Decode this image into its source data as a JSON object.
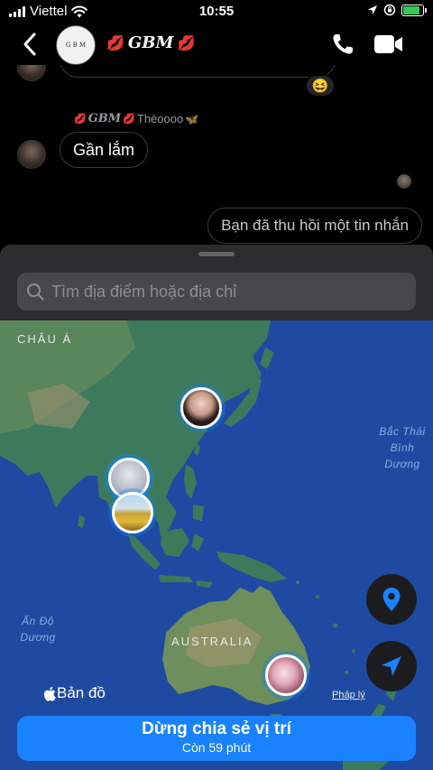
{
  "status_bar": {
    "carrier": "Viettel",
    "time": "10:55",
    "battery_level": 0.9,
    "colors": {
      "battery": "#34c759"
    }
  },
  "chat_header": {
    "title": "GBM",
    "avatar_text": "G B M"
  },
  "messages": [
    {
      "type": "partial-received",
      "reaction": "😆"
    },
    {
      "type": "reply-label",
      "sender": "GBM",
      "text": "Thèoooo"
    },
    {
      "type": "received",
      "text": "Gần lắm"
    },
    {
      "type": "sent-unsent",
      "text": "Bạn đã thu hồi một tin nhắn"
    }
  ],
  "location_sheet": {
    "search_placeholder": "Tìm địa điểm hoặc địa chỉ",
    "map": {
      "labels": {
        "asia": "CHÂU Á",
        "australia": "AUSTRALIA",
        "pacific_ocean": [
          "Bắc Thái",
          "Bình",
          "Dương"
        ],
        "indian_ocean": [
          "Ấn Độ",
          "Dương"
        ]
      },
      "maps_brand": "Bản đồ",
      "legal": "Pháp lý"
    },
    "stop_button": {
      "title": "Dừng chia sẻ vị trí",
      "subtitle": "Còn 59 phút"
    }
  },
  "colors": {
    "accent": "#1a82ff",
    "ocean": "#1f4aa1",
    "land": "#3d7a5c"
  }
}
